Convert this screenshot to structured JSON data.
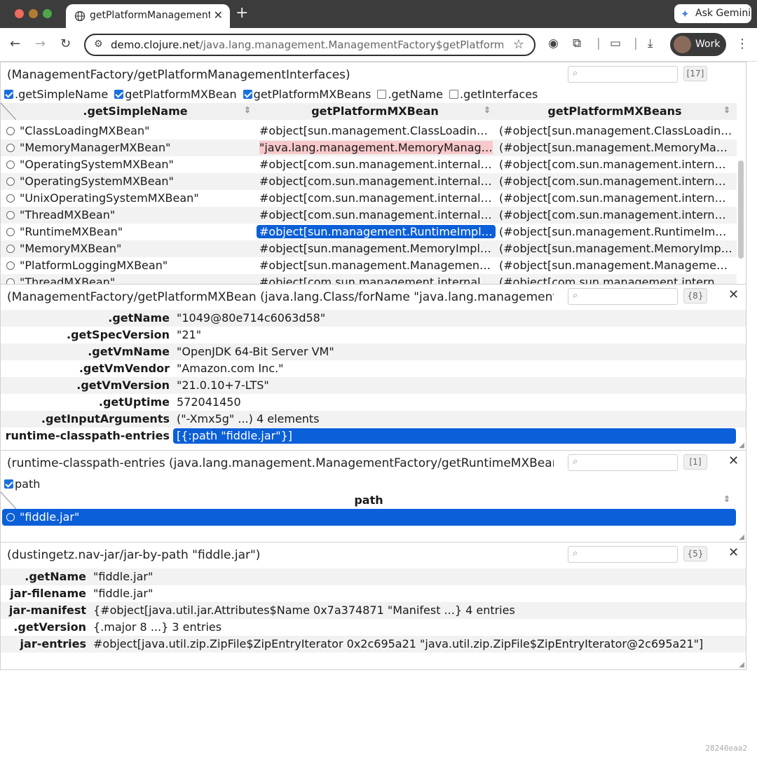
{
  "browser": {
    "tab_title": "getPlatformManagementInter",
    "url_host": "demo.clojure.net",
    "url_path": "/java.lang.management.ManagementFactory$getPlatformManage...",
    "ask_gemini": "Ask Gemini",
    "profile": "Work"
  },
  "panel1": {
    "title": "(ManagementFactory/getPlatformManagementInterfaces)",
    "count": "[17]",
    "column_options": [
      {
        "label": ".getSimpleName",
        "checked": true
      },
      {
        "label": "getPlatformMXBean",
        "checked": true
      },
      {
        "label": "getPlatformMXBeans",
        "checked": true
      },
      {
        "label": ".getName",
        "checked": false
      },
      {
        "label": ".getInterfaces",
        "checked": false
      }
    ],
    "headers": [
      ".getSimpleName",
      "getPlatformMXBean",
      "getPlatformMXBeans"
    ],
    "rows": [
      {
        "name": "\"ClassLoadingMXBean\"",
        "bean": "#object[sun.management.ClassLoadingImpl 0x...",
        "beans": "(#object[sun.management.ClassLoadingImpl 0x..."
      },
      {
        "name": "\"MemoryManagerMXBean\"",
        "bean": "\"java.lang.management.MemoryManagerMXBean\"",
        "beans": "(#object[sun.management.MemoryManagerImpl 0x..."
      },
      {
        "name": "\"OperatingSystemMXBean\"",
        "bean": "#object[com.sun.management.internal.Op...",
        "beans": "(#object[com.sun.management.internal.O..."
      },
      {
        "name": "\"OperatingSystemMXBean\"",
        "bean": "#object[com.sun.management.internal.Op...",
        "beans": "(#object[com.sun.management.internal.O..."
      },
      {
        "name": "\"UnixOperatingSystemMXBean\"",
        "bean": "#object[com.sun.management.internal.Op...",
        "beans": "(#object[com.sun.management.internal.O..."
      },
      {
        "name": "\"ThreadMXBean\"",
        "bean": "#object[com.sun.management.internal.Ho...",
        "beans": "(#object[com.sun.management.internal.Ho..."
      },
      {
        "name": "\"RuntimeMXBean\"",
        "bean": "#object[sun.management.RuntimeImpl 0x...",
        "beans": "(#object[sun.management.RuntimeImpl 0x..."
      },
      {
        "name": "\"MemoryMXBean\"",
        "bean": "#object[sun.management.MemoryImpl 0x...",
        "beans": "(#object[sun.management.MemoryImpl 0x..."
      },
      {
        "name": "\"PlatformLoggingMXBean\"",
        "bean": "#object[sun.management.ManagementFac...",
        "beans": "(#object[sun.management.ManagementFa..."
      },
      {
        "name": "\"ThreadMXBean\"",
        "bean": "#object[com.sun.management.internal.Ho...",
        "beans": "(#object[com.sun.management.internal.Ho..."
      }
    ]
  },
  "panel2": {
    "title": "(ManagementFactory/getPlatformMXBean (java.lang.Class/forName \"java.lang.management.Runtime...",
    "count": "{8}",
    "rows": [
      {
        "key": ".getName",
        "value": "\"1049@80e714c6063d58\""
      },
      {
        "key": ".getSpecVersion",
        "value": "\"21\""
      },
      {
        "key": ".getVmName",
        "value": "\"OpenJDK 64-Bit Server VM\""
      },
      {
        "key": ".getVmVendor",
        "value": "\"Amazon.com Inc.\""
      },
      {
        "key": ".getVmVersion",
        "value": "\"21.0.10+7-LTS\""
      },
      {
        "key": ".getUptime",
        "value": "572041450"
      },
      {
        "key": ".getInputArguments",
        "value": "(\"-Xmx5g\" ...) 4 elements"
      },
      {
        "key": "runtime-classpath-entries",
        "value": "[{:path \"fiddle.jar\"}]"
      }
    ]
  },
  "panel3": {
    "title": "(runtime-classpath-entries (java.lang.management.ManagementFactory/getRuntimeMXBean))",
    "count": "[1]",
    "column_option": "path",
    "header": "path",
    "rows": [
      "\"fiddle.jar\""
    ]
  },
  "panel4": {
    "title": "(dustingetz.nav-jar/jar-by-path \"fiddle.jar\")",
    "count": "{5}",
    "rows": [
      {
        "key": ".getName",
        "value": "\"fiddle.jar\""
      },
      {
        "key": "jar-filename",
        "value": "\"fiddle.jar\""
      },
      {
        "key": "jar-manifest",
        "value": "{#object[java.util.jar.Attributes$Name 0x7a374871 \"Manifest ...} 4 entries"
      },
      {
        "key": ".getVersion",
        "value": "{.major 8 ...} 3 entries"
      },
      {
        "key": "jar-entries",
        "value": "#object[java.util.zip.ZipFile$ZipEntryIterator 0x2c695a21 \"java.util.zip.ZipFile$ZipEntryIterator@2c695a21\"]"
      }
    ]
  },
  "watermark": "28240eaa2"
}
